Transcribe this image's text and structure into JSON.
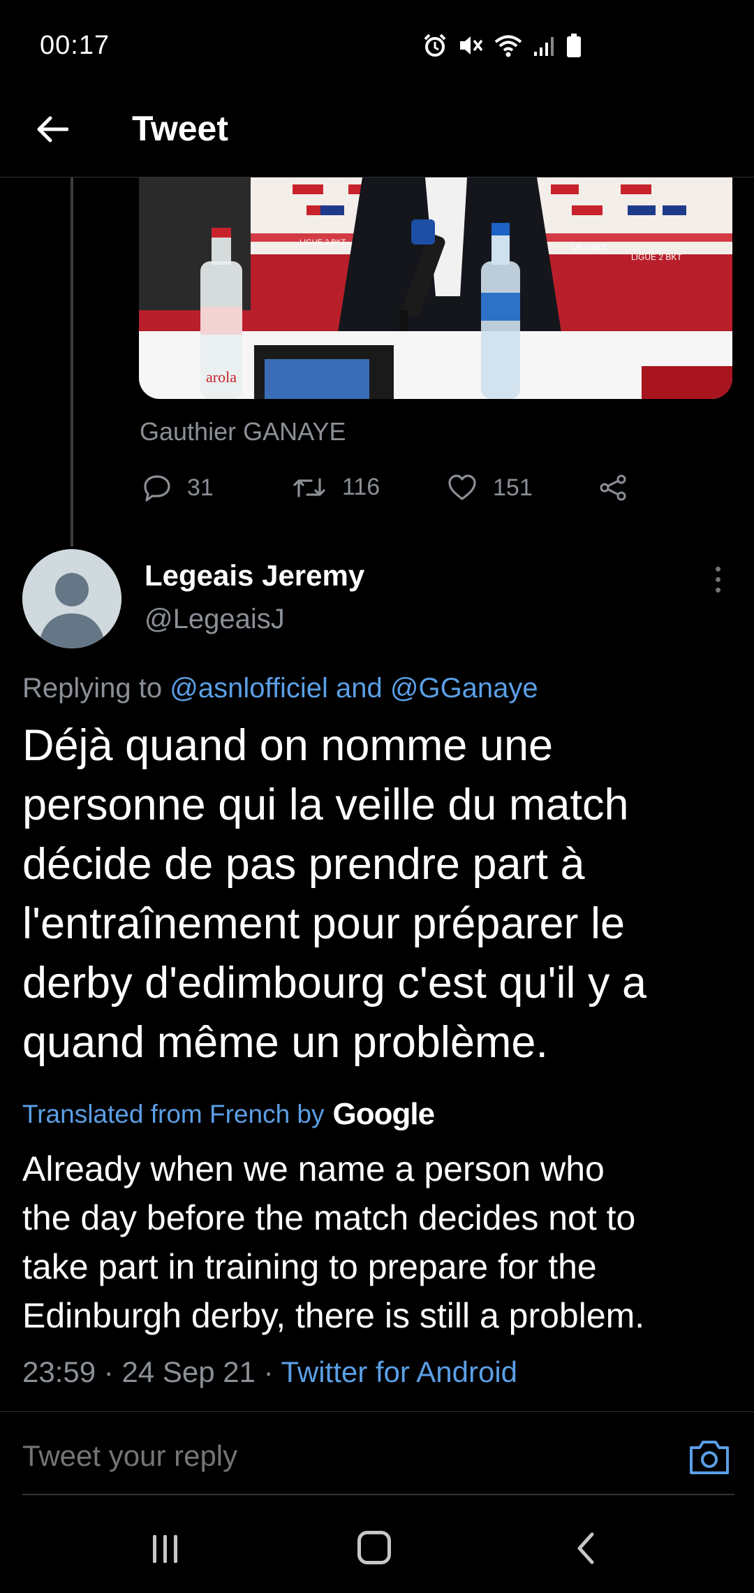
{
  "status_bar": {
    "time": "00:17",
    "icons": [
      "alarm-icon",
      "mute-icon",
      "wifi-icon",
      "signal-icon",
      "battery-icon"
    ]
  },
  "header": {
    "back_icon": "arrow-left-icon",
    "title": "Tweet"
  },
  "media": {
    "caption": "Gauthier GANAYE",
    "bottle_label": "arola"
  },
  "actions": {
    "replies": "31",
    "retweets": "116",
    "likes": "151",
    "share_icon": "share-icon"
  },
  "tweet": {
    "author_name": "Legeais Jeremy",
    "author_handle": "@LegeaisJ",
    "replying_to_prefix": "Replying to ",
    "replying_to_users": [
      "@asnlofficiel",
      "@GGanaye"
    ],
    "replying_to_and": " and ",
    "text": "Déjà quand on nomme une\npersonne qui la veille du match\ndécide de pas prendre part à\nl'entraînement pour préparer le\nderby d'edimbourg c'est qu'il y a\nquand même un problème.",
    "translated_label": "Translated from French by",
    "translator": "Google",
    "translated_text": "Already when we name a person who\nthe day before the match decides not to\ntake part in training to prepare for the\nEdinburgh derby, there is still a problem.",
    "time": "23:59",
    "date": "24 Sep 21",
    "source": "Twitter for Android",
    "separator": " · "
  },
  "reply": {
    "placeholder": "Tweet your reply",
    "camera_icon": "camera-icon"
  },
  "nav_bar": {
    "icons": [
      "recents-icon",
      "home-icon",
      "back-icon"
    ]
  },
  "colors": {
    "background": "#000000",
    "link": "#5b9fe6",
    "muted": "#8b9096"
  }
}
